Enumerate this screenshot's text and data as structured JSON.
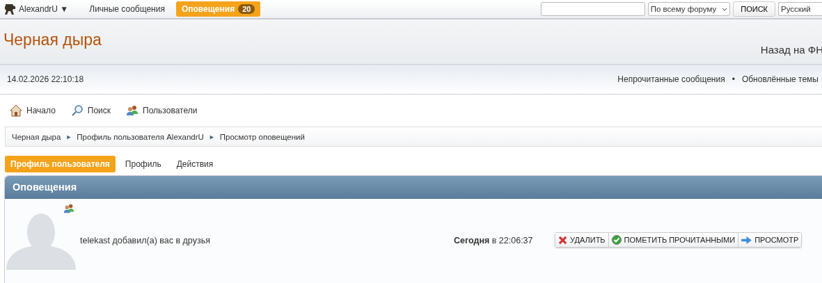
{
  "top_bar": {
    "user": "AlexandrU ▼",
    "links": [
      {
        "label": "Личные сообщения",
        "selected": false
      },
      {
        "label": "Оповещения",
        "badge": "20",
        "selected": true
      }
    ],
    "scope": "По всему форуму",
    "search_button": "ПОИСК",
    "language": "Русский"
  },
  "header": {
    "title": "Черная дыра",
    "back_link": "Назад на ФН"
  },
  "info_bar": {
    "datetime": "14.02.2026 22:10:18",
    "links": [
      "Непрочитанные сообщения",
      "Обновлённые темы"
    ],
    "separator": "•"
  },
  "nav": [
    {
      "kind": "home",
      "label": "Начало"
    },
    {
      "kind": "search",
      "label": "Поиск"
    },
    {
      "kind": "users",
      "label": "Пользователи"
    }
  ],
  "breadcrumb": [
    "Черная дыра",
    "Профиль пользователя AlexandrU",
    "Просмотр оповещений"
  ],
  "breadcrumb_separator": "►",
  "tabs": [
    {
      "label": "Профиль пользователя",
      "selected": true
    },
    {
      "label": "Профиль",
      "selected": false
    },
    {
      "label": "Действия",
      "selected": false
    }
  ],
  "panel": {
    "title": "Оповещения",
    "notifications": [
      {
        "message": "telekast добавил(а) вас в друзья",
        "time": "**Сегодня** в 22:06:37",
        "actions": [
          {
            "kind": "delete",
            "label": "УДАЛИТЬ"
          },
          {
            "kind": "mark_read",
            "label": "ПОМЕТИТЬ ПРОЧИТАННЫМИ"
          },
          {
            "kind": "view",
            "label": "ПРОСМОТР"
          }
        ]
      }
    ]
  }
}
